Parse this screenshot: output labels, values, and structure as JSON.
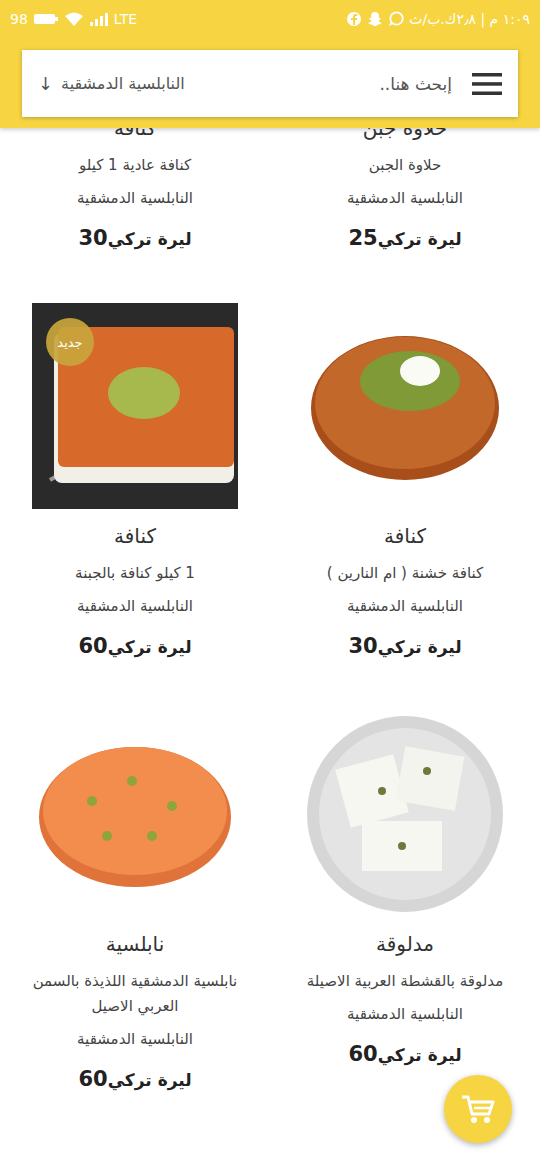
{
  "status_bar": {
    "time": "١:٠٩ م | ٢٫٨ك.ب/ث",
    "battery": "98",
    "network": "LTE"
  },
  "header": {
    "search_placeholder": "إبحث هنا..",
    "store": "النابلسية الدمشقية",
    "store_arrow": "↓"
  },
  "products": [
    {
      "kind": "none",
      "title": "حلاوة جبن",
      "description": "حلاوة الجبن",
      "shop": "النابلسية الدمشقية",
      "price": "25",
      "currency": "ليرة تركي"
    },
    {
      "kind": "none",
      "title": "كنافة",
      "description": "كنافة عادية 1 كيلو",
      "shop": "النابلسية الدمشقية",
      "price": "30",
      "currency": "ليرة تركي"
    },
    {
      "kind": "round-kunafa",
      "title": "كنافة",
      "description": "كنافة خشنة ( ام النارين )",
      "shop": "النابلسية الدمشقية",
      "price": "30",
      "currency": "ليرة تركي"
    },
    {
      "kind": "square-kunafa",
      "title": "كنافة",
      "description": "1 كيلو كنافة بالجبنة",
      "shop": "النابلسية الدمشقية",
      "price": "60",
      "currency": "ليرة تركي",
      "badge": "جديد"
    },
    {
      "kind": "madlouqa",
      "title": "مدلوقة",
      "description": "مدلوقة بالقشطة العربية الاصيلة",
      "shop": "النابلسية الدمشقية",
      "price": "60",
      "currency": "ليرة تركي"
    },
    {
      "kind": "nabulsia",
      "title": "نابلسية",
      "description": "نابلسية الدمشقية اللذيذة بالسمن العربي الاصيل",
      "shop": "النابلسية الدمشقية",
      "price": "60",
      "currency": "ليرة تركي"
    }
  ]
}
